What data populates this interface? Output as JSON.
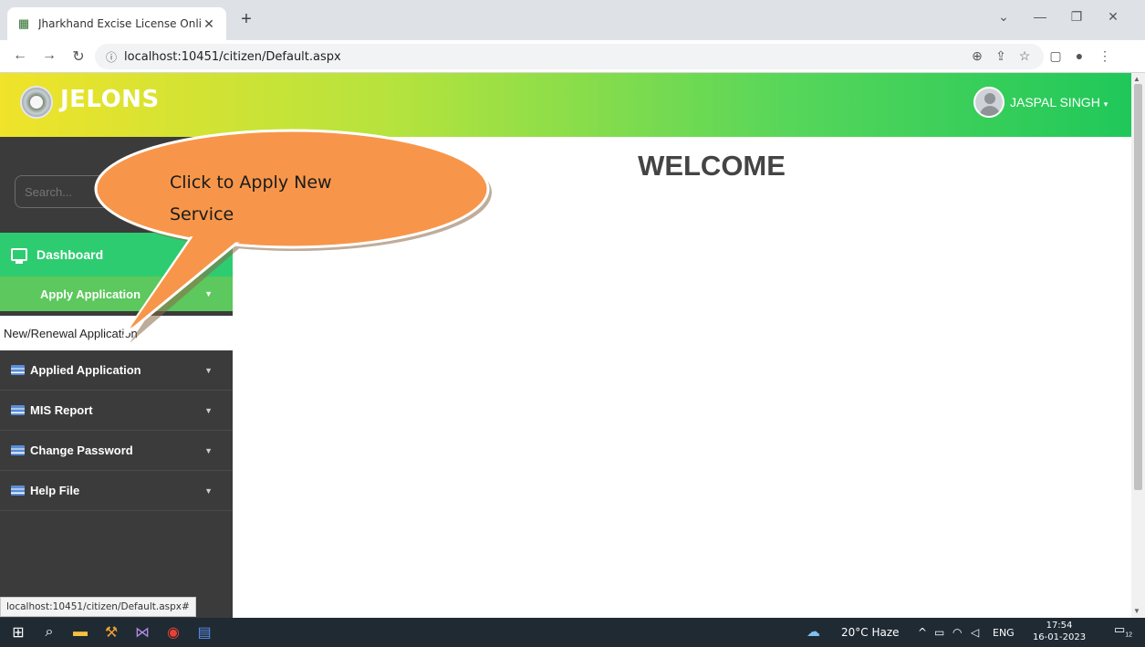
{
  "browser": {
    "tab_title": "Jharkhand Excise License Online",
    "url": "localhost:10451/citizen/Default.aspx",
    "status_url": "localhost:10451/citizen/Default.aspx#"
  },
  "header": {
    "brand": "JELONS",
    "user_name": "JASPAL SINGH"
  },
  "sidebar": {
    "search_placeholder": "Search...",
    "dashboard": "Dashboard",
    "apply_application": "Apply Application",
    "new_renewal": "New/Renewal Application",
    "items": [
      {
        "label": "Applied Application"
      },
      {
        "label": "MIS Report"
      },
      {
        "label": "Change Password"
      },
      {
        "label": "Help File"
      }
    ]
  },
  "main": {
    "welcome": "WELCOME"
  },
  "callout": {
    "text": "Click to Apply New Service"
  },
  "taskbar": {
    "weather": "20°C  Haze",
    "language": "ENG",
    "time": "17:54",
    "date": "16-01-2023",
    "notification_count": "12"
  },
  "colors": {
    "header_start": "#f0e32a",
    "header_end": "#1fc85a",
    "dashboard_bg": "#2ecc71",
    "apply_bg": "#5cc85d",
    "sidebar_bg": "#3b3b3b",
    "callout_fill": "#f7964a"
  }
}
